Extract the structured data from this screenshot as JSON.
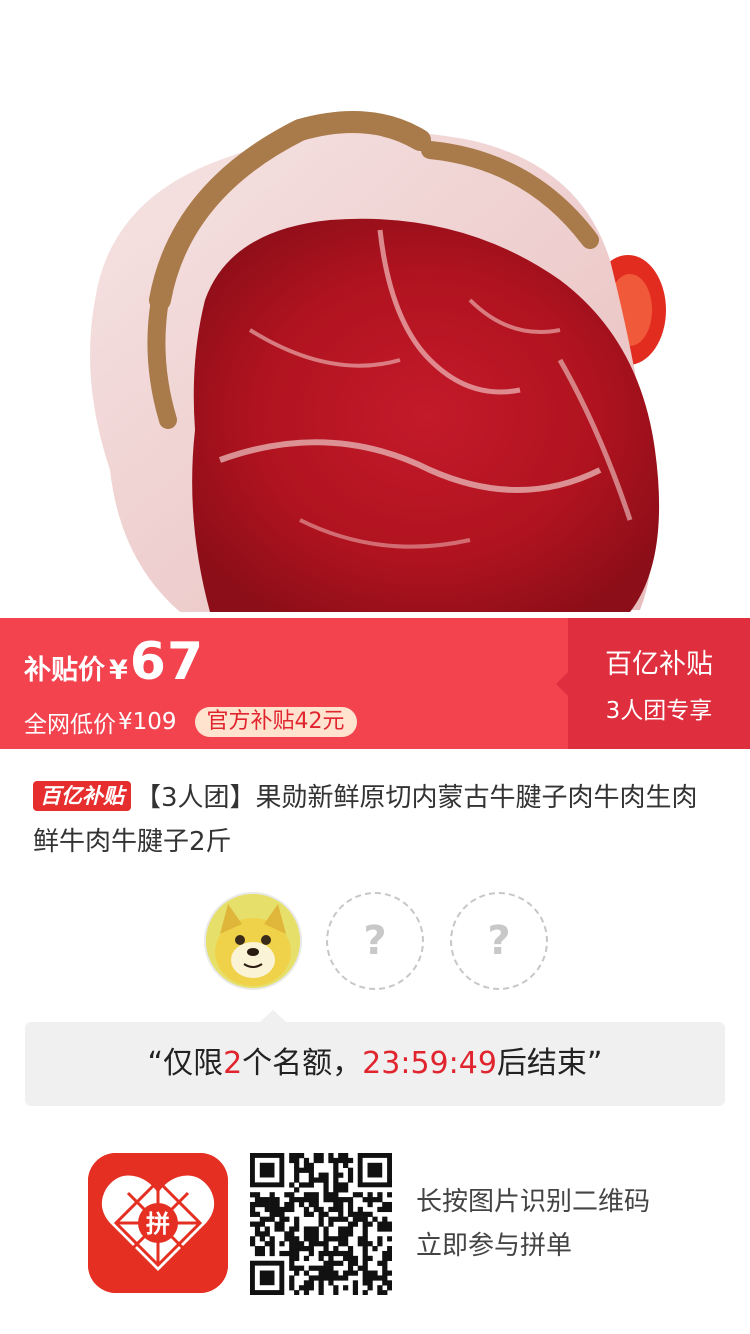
{
  "product_image": {
    "icon": "raw-beef-shank-image"
  },
  "price": {
    "label": "补贴价",
    "currency": "¥",
    "value": "67",
    "low_label": "全网低价",
    "low_value": "¥109",
    "subsidy_pill": "官方补贴42元"
  },
  "brand": {
    "title": "百亿补贴",
    "subtitle": "3人团专享"
  },
  "title": {
    "badge": "百亿补贴",
    "text": "【3人团】果勋新鲜原切内蒙古牛腱子肉牛肉生肉鲜牛肉牛腱子2斤"
  },
  "group": {
    "member_avatar": "doge-avatar",
    "empty_slot_mark": "?"
  },
  "notice": {
    "open_quote": "“",
    "prefix": "仅限",
    "count": "2",
    "middle": "个名额，",
    "timer": "23:59:49",
    "suffix": "后结束",
    "close_quote": "”"
  },
  "footer": {
    "logo_icon": "pinduoduo-logo-icon",
    "logo_text": "拼",
    "qr_icon": "qr-code-icon",
    "line1": "长按图片识别二维码",
    "line2": "立即参与拼单"
  },
  "colors": {
    "primary_red": "#f2434f",
    "dark_red": "#df2e3d",
    "pill_bg": "#ffe3cf",
    "logo_red": "#e52f22"
  }
}
